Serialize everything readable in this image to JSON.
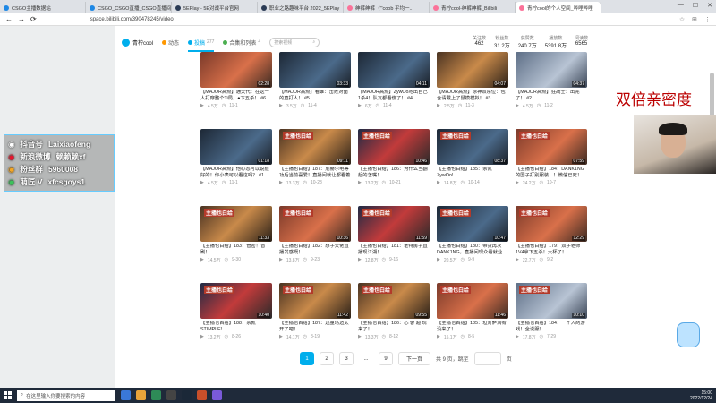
{
  "browser": {
    "tabs": [
      {
        "label": "CSGO主播数据站",
        "icon": "stats-favicon",
        "active": false
      },
      {
        "label": "CSGO_CSGO直播_CSGO直播间",
        "icon": "live-favicon",
        "active": false
      },
      {
        "label": "5EPlay - 5E对战平台官网",
        "icon": "5e-favicon",
        "active": false
      },
      {
        "label": "职业之路趣味平台 2022_5EPlay",
        "icon": "5e-favicon",
        "active": false
      },
      {
        "label": "绅裤绅裤（\"'coob 平均一..",
        "icon": "bili-favicon",
        "active": false
      },
      {
        "label": "青柠cool-绅裤绅裤_Bilibili",
        "icon": "bili-favicon",
        "active": false
      },
      {
        "label": "青柠cool的个人空间_哔哩哔哩",
        "icon": "bili-favicon",
        "active": true
      }
    ],
    "url": "space.bilibili.com/390478245/video"
  },
  "nav": {
    "brand": "青柠cool",
    "items": [
      {
        "label": "动态",
        "count": "",
        "active": false
      },
      {
        "label": "投稿",
        "count": "277",
        "active": true
      },
      {
        "label": "合集和列表",
        "count": "4",
        "active": false
      }
    ],
    "search_placeholder": "搜索视频"
  },
  "stats": [
    {
      "label": "关注数",
      "value": "462"
    },
    {
      "label": "粉丝数",
      "value": "31.2万"
    },
    {
      "label": "获赞数",
      "value": "240.7万"
    },
    {
      "label": "播放数",
      "value": "5391.8万"
    },
    {
      "label": "阅读数",
      "value": "6565"
    }
  ],
  "videos": [
    {
      "title": "【MAJOR高燃】通天代：在这一人打穿整个Ti局，●下五杀！ #6",
      "views": "4.5万",
      "date": "11-1",
      "duration": "02:28",
      "style": "t-red",
      "sign": ""
    },
    {
      "title": "【MAJOR高燃】看谁：击败对面的直打人！ #5",
      "views": "3.5万",
      "date": "11-4",
      "duration": "03:33",
      "style": "t-blue",
      "sign": ""
    },
    {
      "title": "【MAJOR高燃】ZywOo地出自己1杀4！队友都看傻了！ #4",
      "views": "6万",
      "date": "11-4",
      "duration": "04:11",
      "style": "t-blue",
      "sign": ""
    },
    {
      "title": "【MAJOR高燃】凉神双杀位：包含请戴上了鼠模模拟！ #3",
      "views": "2.5万",
      "date": "11-3",
      "duration": "04:07",
      "style": "t-warm",
      "sign": ""
    },
    {
      "title": "【MAJOR高燃】狂战士：出完了！ #2",
      "views": "4.5万",
      "date": "11-2",
      "duration": "04:37",
      "style": "t-ice",
      "sign": ""
    },
    {
      "title": "【MAJOR高燃】他心态可以说很好的！你小表可以看这吗？ #1",
      "views": "4.5万",
      "date": "11-1",
      "duration": "01:18",
      "style": "t-blue",
      "sign": ""
    },
    {
      "title": "【主播也白给】187：尼赫尔电等功后当前喜爱！直播间就让都看着",
      "views": "13.3万",
      "date": "10-28",
      "duration": "09:11",
      "style": "t-warm",
      "sign": "主播也白给"
    },
    {
      "title": "【主播也白给】186：为什么当翻起的怎嘴！",
      "views": "13.2万",
      "date": "10-21",
      "duration": "10:46",
      "style": "t-stage",
      "sign": "主播也白给"
    },
    {
      "title": "【主播也白给】185：余凯ZywOo!",
      "views": "14.8万",
      "date": "10-14",
      "duration": "08:37",
      "style": "t-blue",
      "sign": "主播也白给"
    },
    {
      "title": "【主播也白给】184：DANK1NG的国子打别服装！！微信已死！",
      "views": "24.2万",
      "date": "10-7",
      "duration": "07:59",
      "style": "t-red",
      "sign": "主播也白给"
    },
    {
      "title": "【主播也白给】183：管密！冒刷！",
      "views": "14.5万",
      "date": "9-30",
      "duration": "11:33",
      "style": "t-warm",
      "sign": "主播也白给"
    },
    {
      "title": "【主播也白给】182：想子大佬直播发感慨！",
      "views": "13.8万",
      "date": "9-23",
      "duration": "10:36",
      "style": "t-red",
      "sign": "主播也白给"
    },
    {
      "title": "【主播也白给】181：老特房子直播现江湖！",
      "views": "12.8万",
      "date": "9-16",
      "duration": "11:59",
      "style": "t-stage",
      "sign": "主播也白给"
    },
    {
      "title": "【主播也白给】180：带货再次DANK1NG，直播间现众看就业",
      "views": "20.5万",
      "date": "9-9",
      "duration": "10:47",
      "style": "t-blue",
      "sign": "主播也白给"
    },
    {
      "title": "【主播也白给】179：双子老师1V4拿下五杀！大杯了！",
      "views": "22.7万",
      "date": "9-2",
      "duration": "12:29",
      "style": "t-red",
      "sign": "主播也白给"
    },
    {
      "title": "【主播也白给】188：余凯STIMPLE!",
      "views": "13.2万",
      "date": "8-26",
      "duration": "10:40",
      "style": "t-stage",
      "sign": "主播也白给"
    },
    {
      "title": "【主播也白给】187：迅量场边太开了吧！",
      "views": "14.1万",
      "date": "8-19",
      "duration": "11:42",
      "style": "t-warm",
      "sign": "主播也白给"
    },
    {
      "title": "【主播也白给】186：心 客 超 现 来了！",
      "views": "13.3万",
      "date": "8-12",
      "duration": "09:55",
      "style": "t-warm",
      "sign": "主播也白给"
    },
    {
      "title": "【主播也白给】185：坦对萨满有没来了！",
      "views": "15.1万",
      "date": "8-5",
      "duration": "11:46",
      "style": "t-red",
      "sign": "主播也白给"
    },
    {
      "title": "【主播也白给】184：一个人的游戏！全说服！",
      "views": "17.8万",
      "date": "7-29",
      "duration": "10:10",
      "style": "t-ice",
      "sign": "主播也白给"
    }
  ],
  "pager": {
    "pages": [
      "1",
      "2",
      "3",
      "...",
      "9"
    ],
    "active": "1",
    "next_label": "下一页",
    "total_text": "共 9 页，跳至",
    "suffix": "页"
  },
  "overlay": {
    "lines": [
      {
        "icon": "douyin-icon",
        "label": "抖音号",
        "value": "Laixiaofeng"
      },
      {
        "icon": "weibo-icon",
        "label": "新浪微博",
        "value": "赖赖赖xf"
      },
      {
        "icon": "fans-icon",
        "label": "粉丝群",
        "value": "5960008"
      },
      {
        "icon": "wechat-icon",
        "label": "萌匠 V",
        "value": "xfcsgoys1"
      }
    ],
    "promo_text": "双倍亲密度"
  },
  "taskbar": {
    "search_placeholder": "在这里输入你要搜索的内容",
    "time": "15:00",
    "date": "2022/12/24"
  }
}
